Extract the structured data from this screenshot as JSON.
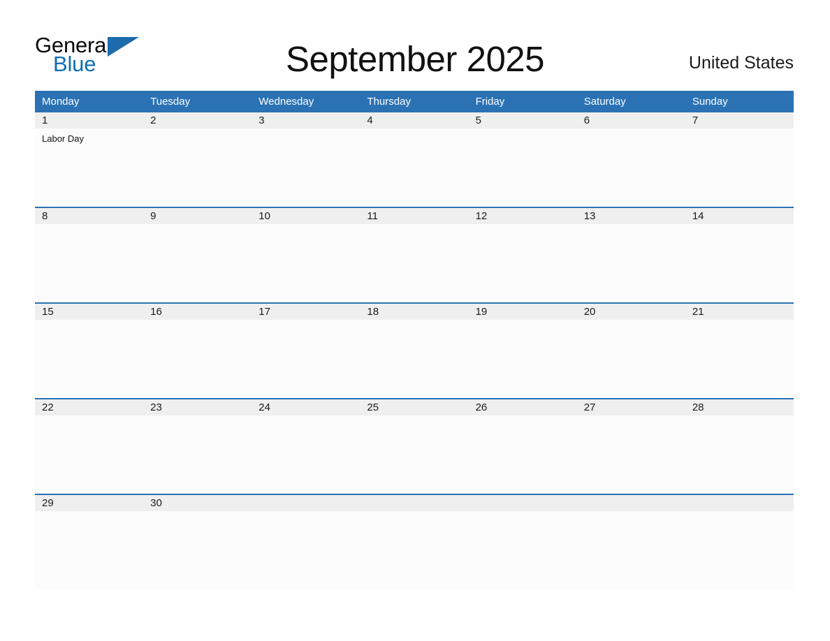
{
  "brand": {
    "name_line1": "General",
    "name_line2": "Blue",
    "color_dark": "#0a0a0a",
    "color_blue": "#0E6DB5",
    "triangle_color": "#1B6BAD"
  },
  "header": {
    "title": "September 2025",
    "country": "United States"
  },
  "theme": {
    "header_blue": "#2B72B4",
    "daynum_gray": "#EFEFEF",
    "cell_white": "#FCFCFC",
    "text_dark": "#111111"
  },
  "weekdays": [
    "Monday",
    "Tuesday",
    "Wednesday",
    "Thursday",
    "Friday",
    "Saturday",
    "Sunday"
  ],
  "weeks": [
    {
      "days": [
        {
          "num": "1",
          "events": [
            "Labor Day"
          ]
        },
        {
          "num": "2",
          "events": []
        },
        {
          "num": "3",
          "events": []
        },
        {
          "num": "4",
          "events": []
        },
        {
          "num": "5",
          "events": []
        },
        {
          "num": "6",
          "events": []
        },
        {
          "num": "7",
          "events": []
        }
      ]
    },
    {
      "days": [
        {
          "num": "8",
          "events": []
        },
        {
          "num": "9",
          "events": []
        },
        {
          "num": "10",
          "events": []
        },
        {
          "num": "11",
          "events": []
        },
        {
          "num": "12",
          "events": []
        },
        {
          "num": "13",
          "events": []
        },
        {
          "num": "14",
          "events": []
        }
      ]
    },
    {
      "days": [
        {
          "num": "15",
          "events": []
        },
        {
          "num": "16",
          "events": []
        },
        {
          "num": "17",
          "events": []
        },
        {
          "num": "18",
          "events": []
        },
        {
          "num": "19",
          "events": []
        },
        {
          "num": "20",
          "events": []
        },
        {
          "num": "21",
          "events": []
        }
      ]
    },
    {
      "days": [
        {
          "num": "22",
          "events": []
        },
        {
          "num": "23",
          "events": []
        },
        {
          "num": "24",
          "events": []
        },
        {
          "num": "25",
          "events": []
        },
        {
          "num": "26",
          "events": []
        },
        {
          "num": "27",
          "events": []
        },
        {
          "num": "28",
          "events": []
        }
      ]
    },
    {
      "days": [
        {
          "num": "29",
          "events": []
        },
        {
          "num": "30",
          "events": []
        },
        {
          "num": "",
          "events": []
        },
        {
          "num": "",
          "events": []
        },
        {
          "num": "",
          "events": []
        },
        {
          "num": "",
          "events": []
        },
        {
          "num": "",
          "events": []
        }
      ]
    }
  ]
}
